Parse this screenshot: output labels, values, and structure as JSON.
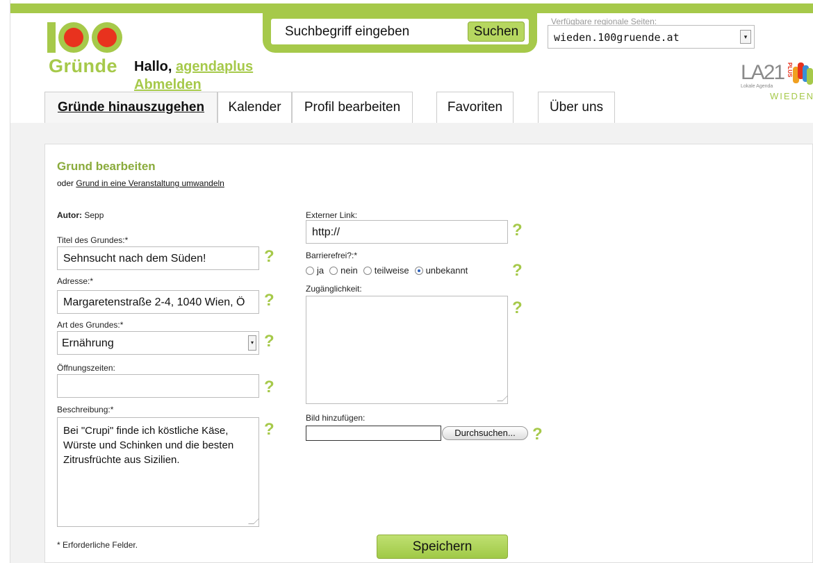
{
  "logo": {
    "digits": "100",
    "word": "Gründe"
  },
  "header": {
    "greeting": "Hallo,",
    "username": "agendaplus",
    "logout": "Abmelden"
  },
  "search": {
    "placeholder": "Suchbegriff eingeben",
    "button": "Suchen"
  },
  "region": {
    "label": "Verfügbare regionale Seiten:",
    "selected": "wieden.100gruende.at"
  },
  "la21": {
    "text": "LA21",
    "plus": "PLUS",
    "sub": "Lokale Agenda",
    "district": "WIEDEN"
  },
  "tabs": [
    {
      "label": "Gründe hinauszugehen",
      "active": true
    },
    {
      "label": "Kalender",
      "active": false
    },
    {
      "label": "Profil bearbeiten",
      "active": false
    },
    {
      "label": "Favoriten",
      "active": false
    },
    {
      "label": "Über uns",
      "active": false
    }
  ],
  "form": {
    "heading": "Grund bearbeiten",
    "sub_prefix": "oder ",
    "sub_link": "Grund in eine Veranstaltung umwandeln",
    "author_label": "Autor:",
    "author_value": "Sepp",
    "title_label": "Titel des Grundes:*",
    "title_value": "Sehnsucht nach dem Süden!",
    "address_label": "Adresse:*",
    "address_value": "Margaretenstraße 2-4, 1040 Wien, Ö",
    "type_label": "Art des Grundes:*",
    "type_value": "Ernährung",
    "hours_label": "Öffnungszeiten:",
    "hours_value": "",
    "desc_label": "Beschreibung:*",
    "desc_value": "Bei \"Crupi\" finde ich köstliche Käse, Würste und Schinken und die besten Zitrusfrüchte aus Sizilien.",
    "link_label": "Externer Link:",
    "link_value": "http://",
    "barrier_label": "Barrierefrei?:*",
    "barrier_options": [
      "ja",
      "nein",
      "teilweise",
      "unbekannt"
    ],
    "barrier_selected": "unbekannt",
    "access_label": "Zugänglichkeit:",
    "access_value": "",
    "image_label": "Bild hinzufügen:",
    "browse_button": "Durchsuchen...",
    "help_glyph": "?",
    "required_note": "* Erforderliche Felder.",
    "save_button": "Speichern"
  },
  "colors": {
    "accent": "#a6c94a",
    "logo_red": "#e8321e",
    "heading": "#8aab3c"
  }
}
